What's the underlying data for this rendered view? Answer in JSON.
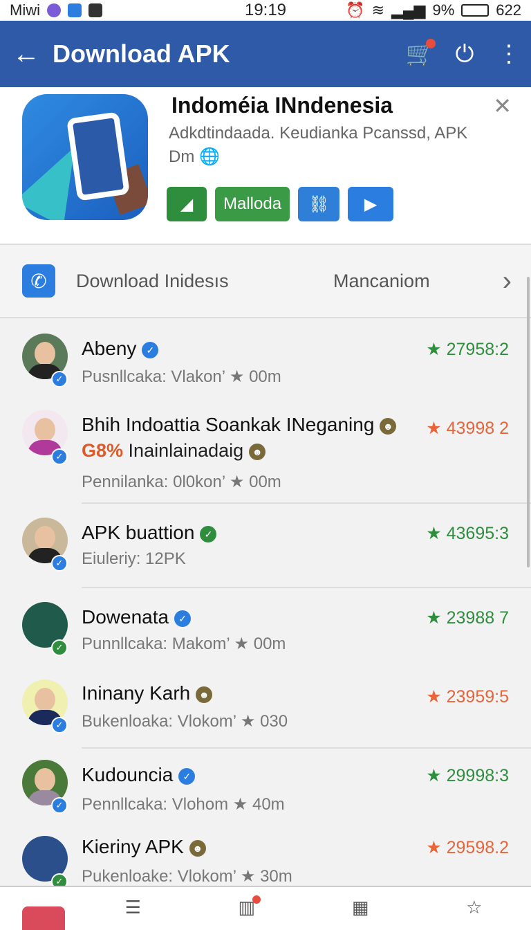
{
  "status_bar": {
    "carrier": "Miwi",
    "time": "19:19",
    "battery": "9%",
    "right_text": "622"
  },
  "header": {
    "title": "Download APK"
  },
  "app": {
    "title": "Indoméia INndenesia",
    "subtitle_line1": "Adkdtindaada. Keudianka Pcanssd, APK",
    "subtitle_line2": "Dm",
    "button_label": "Malloda"
  },
  "contact": {
    "label": "Download Inidesıs",
    "right_label": "Mancaniom"
  },
  "list": [
    {
      "name": "Abeny",
      "sub": "Pusnllcaka: Vlakon’ ★ 00m",
      "score": "27958:2",
      "star_color": "green",
      "verify_color": "#2b7de0"
    },
    {
      "name": "Bhih Indoattia Soankak INeganing",
      "highlight_pct": "G8%",
      "highlight_rest": "Inainlainadaig",
      "sub": "Pennilanka: 0l0kon’ ★ 00m",
      "score": "43998 2",
      "star_color": "orange",
      "verify_color": "#7a6a3a"
    },
    {
      "name": "APK buattion",
      "sub": "Eiuleriy: 12PK",
      "score": "43695:3",
      "star_color": "green",
      "verify_color": "#2f8e3e"
    },
    {
      "name": "Dowenata",
      "sub": "Punnllcaka: Makom’ ★ 00m",
      "score": "23988 7",
      "star_color": "green",
      "verify_color": "#2b7de0"
    },
    {
      "name": "Ininany Karh",
      "sub": "Bukenloaka: Vlokom’ ★ 030",
      "score": "23959:5",
      "star_color": "orange",
      "verify_color": "#7a6a3a"
    },
    {
      "name": "Kudouncia",
      "sub": "Pennllcaka: Vlohom ★ 40m",
      "score": "29998:3",
      "star_color": "green",
      "verify_color": "#2b7de0"
    },
    {
      "name": "Kieriny APK",
      "sub": "Pukenloake: Vlokom’ ★ 30m",
      "score": "29598.2",
      "star_color": "orange",
      "verify_color": "#7a6a3a"
    }
  ],
  "colors": {
    "appbar": "#2e5aa8",
    "green": "#2f8e3e",
    "orange": "#e8643a",
    "blue": "#2b7de0"
  }
}
